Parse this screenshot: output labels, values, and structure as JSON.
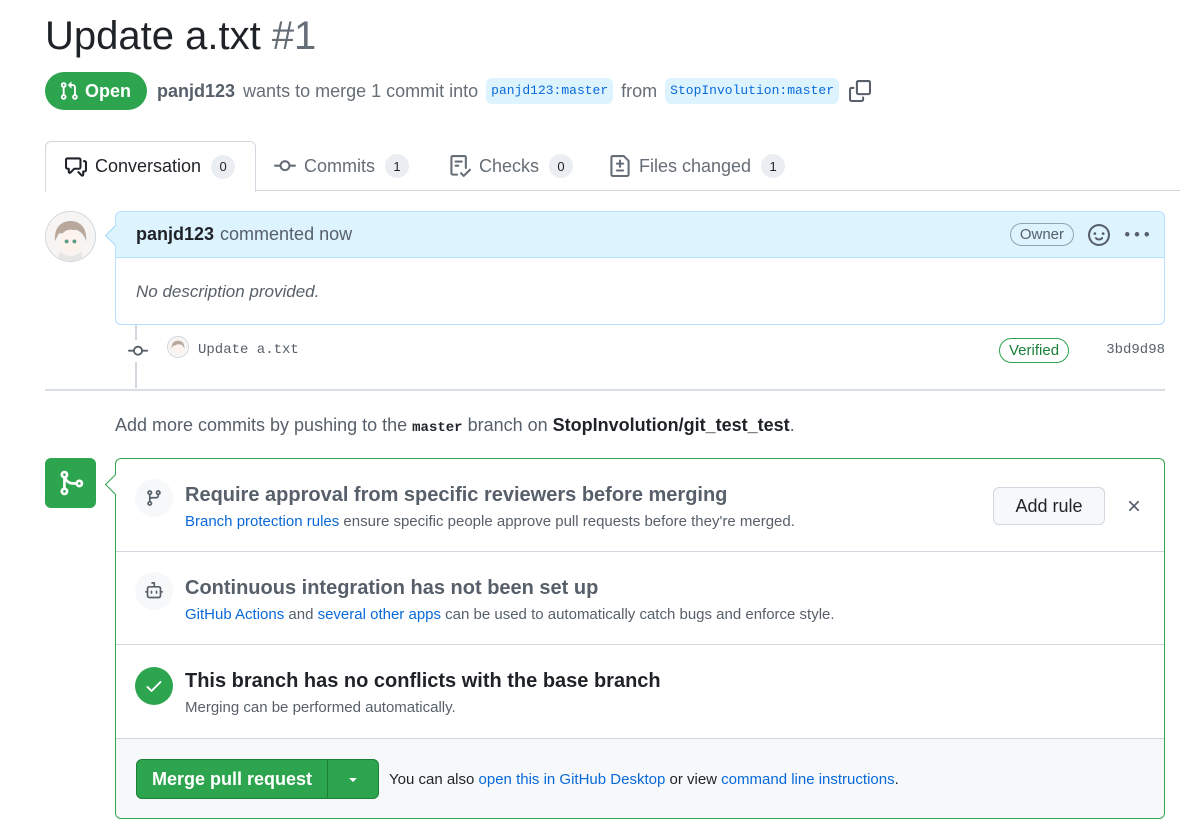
{
  "pr": {
    "title": "Update a.txt",
    "number": "#1",
    "state": "Open",
    "author": "panjd123",
    "merge_text": "wants to merge 1 commit into",
    "base_branch": "panjd123:master",
    "from_text": "from",
    "head_branch": "StopInvolution:master"
  },
  "tabs": [
    {
      "label": "Conversation",
      "count": "0",
      "icon": "comment-discussion-icon"
    },
    {
      "label": "Commits",
      "count": "1",
      "icon": "git-commit-icon"
    },
    {
      "label": "Checks",
      "count": "0",
      "icon": "checklist-icon"
    },
    {
      "label": "Files changed",
      "count": "1",
      "icon": "file-diff-icon"
    }
  ],
  "comment": {
    "author": "panjd123",
    "action": "commented now",
    "badge": "Owner",
    "body": "No description provided."
  },
  "commit": {
    "message": "Update a.txt",
    "verified": "Verified",
    "sha": "3bd9d98"
  },
  "hint": {
    "prefix": "Add more commits by pushing to the",
    "branch": "master",
    "middle": "branch on",
    "repo": "StopInvolution/git_test_test",
    "suffix": "."
  },
  "merge": {
    "protection": {
      "title": "Require approval from specific reviewers before merging",
      "link": "Branch protection rules",
      "text": "ensure specific people approve pull requests before they're merged.",
      "button": "Add rule",
      "dismiss": "×"
    },
    "ci": {
      "title": "Continuous integration has not been set up",
      "link1": "GitHub Actions",
      "and": "and",
      "link2": "several other apps",
      "text": "can be used to automatically catch bugs and enforce style."
    },
    "conflicts": {
      "title": "This branch has no conflicts with the base branch",
      "text": "Merging can be performed automatically."
    },
    "footer": {
      "button": "Merge pull request",
      "prefix": "You can also",
      "link1": "open this in GitHub Desktop",
      "middle": "or view",
      "link2": "command line instructions",
      "suffix": "."
    }
  },
  "colors": {
    "green": "#2da44e",
    "blue_link": "#0969da",
    "comment_header": "#ddf4ff"
  }
}
